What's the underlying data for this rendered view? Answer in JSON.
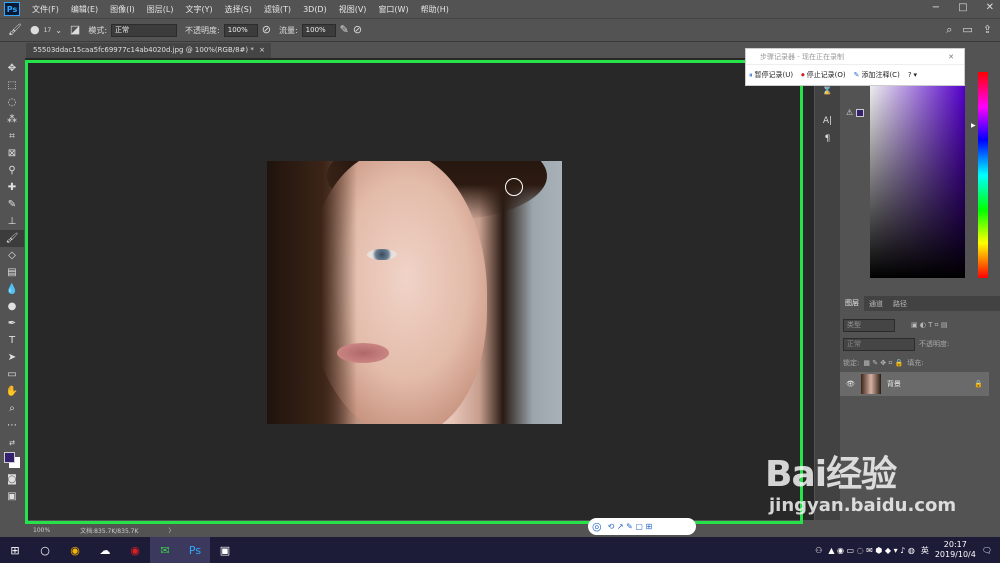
{
  "menubar": {
    "items": [
      "文件(F)",
      "编辑(E)",
      "图像(I)",
      "图层(L)",
      "文字(Y)",
      "选择(S)",
      "滤镜(T)",
      "3D(D)",
      "视图(V)",
      "窗口(W)",
      "帮助(H)"
    ],
    "logo": "Ps"
  },
  "options": {
    "brush_size": "17",
    "mode_label": "模式:",
    "mode_value": "正常",
    "opacity_label": "不透明度:",
    "opacity_value": "100%",
    "flow_label": "流量:",
    "flow_value": "100%"
  },
  "document": {
    "tab_title": "55503ddac15caa5fc69977c14ab4020d.jpg @ 100%(RGB/8#) *",
    "zoom": "100%",
    "doc_size": "文档:835.7K/835.7K"
  },
  "recorder": {
    "title": "步骤记录器 - 现在正在录制",
    "pause_label": "暂停记录(U)",
    "stop_label": "停止记录(O)",
    "annotate_label": "添加注释(C)"
  },
  "layers": {
    "tabs": [
      "图层",
      "通道",
      "路径"
    ],
    "filter_placeholder": "类型",
    "blend_mode": "正常",
    "opacity_label": "不透明度:",
    "lock_label": "锁定:",
    "fill_label": "填充:",
    "layer_name": "背景"
  },
  "colors": {
    "foreground": "#33206e",
    "background": "#ffffff",
    "highlight_box": "#27e34a"
  },
  "taskbar": {
    "time": "20:17",
    "date": "2019/10/4",
    "lang": "英"
  },
  "watermark": {
    "brand": "Bai经验",
    "url": "jingyan.baidu.com"
  }
}
